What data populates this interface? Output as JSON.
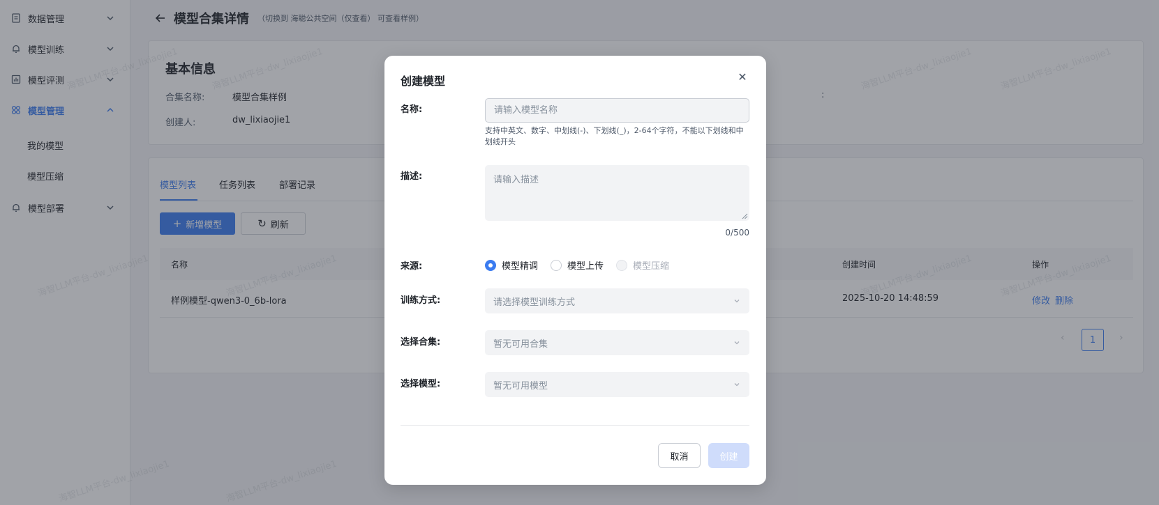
{
  "sidebar": {
    "items": [
      {
        "label": "数据管理",
        "icon": "document-icon"
      },
      {
        "label": "模型训练",
        "icon": "bell-icon"
      },
      {
        "label": "模型评测",
        "icon": "bar-chart-icon"
      },
      {
        "label": "模型管理",
        "icon": "grid-icon"
      },
      {
        "label": "模型部署",
        "icon": "bell-icon"
      }
    ],
    "subitems": [
      "我的模型",
      "模型压缩"
    ]
  },
  "header": {
    "title": "模型合集详情",
    "hint": "（切换到 海聪公共空间（仅查看） 可查看样例）"
  },
  "info": {
    "title": "基本信息",
    "collection_label": "合集名称:",
    "collection_value": "模型合集样例",
    "creator_label": "创建人:",
    "creator_value": "dw_lixiaojie1",
    "colon": ":"
  },
  "tabs": [
    "模型列表",
    "任务列表",
    "部署记录"
  ],
  "toolbar": {
    "add_label": "新增模型",
    "refresh_label": "刷新"
  },
  "table": {
    "columns": [
      "名称",
      "创建时间",
      "操作"
    ],
    "rows": [
      {
        "name": "样例模型-qwen3-0_6b-lora",
        "created": "2025-10-20 14:48:59",
        "edit": "修改",
        "delete": "删除"
      }
    ]
  },
  "pagination": {
    "current": "1"
  },
  "watermark": "海智LLM平台-dw_lixiaojie1",
  "modal": {
    "title": "创建模型",
    "name_label": "名称:",
    "name_placeholder": "请输入模型名称",
    "name_help": "支持中英文、数字、中划线(-)、下划线(_)，2-64个字符，不能以下划线和中划线开头",
    "desc_label": "描述:",
    "desc_placeholder": "请输入描述",
    "desc_count": "0/500",
    "source_label": "来源:",
    "source_options": [
      {
        "label": "模型精调",
        "state": "checked"
      },
      {
        "label": "模型上传",
        "state": "unchecked"
      },
      {
        "label": "模型压缩",
        "state": "disabled"
      }
    ],
    "train_label": "训练方式:",
    "train_placeholder": "请选择模型训练方式",
    "collection_label": "选择合集:",
    "collection_placeholder": "暂无可用合集",
    "model_label": "选择模型:",
    "model_placeholder": "暂无可用模型",
    "cancel_label": "取消",
    "create_label": "创建"
  },
  "colors": {
    "accent": "#3b7cf0",
    "create_disabled": "#cfdcfb"
  }
}
